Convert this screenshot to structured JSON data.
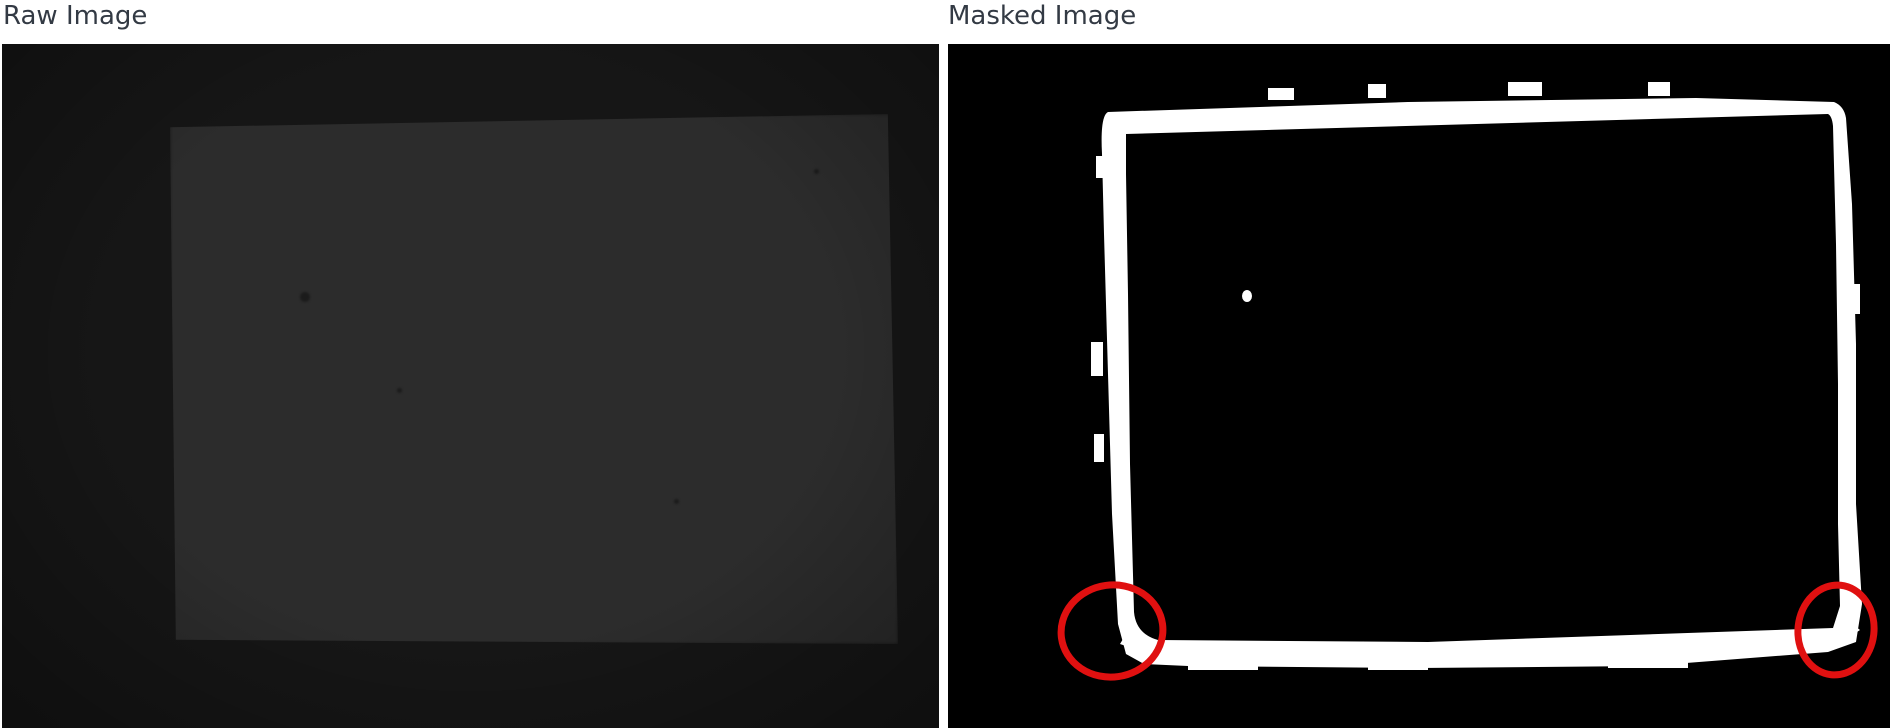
{
  "panels": {
    "raw": {
      "title": "Raw Image"
    },
    "masked": {
      "title": "Masked Image"
    }
  },
  "colors": {
    "raw_background": "#161616",
    "raw_card": "#2c2c2c",
    "mask_background": "#000000",
    "mask_foreground": "#ffffff",
    "annotation": "#e01010"
  },
  "annotations": {
    "circled_regions": [
      "bottom-left corner",
      "bottom-right corner"
    ]
  }
}
